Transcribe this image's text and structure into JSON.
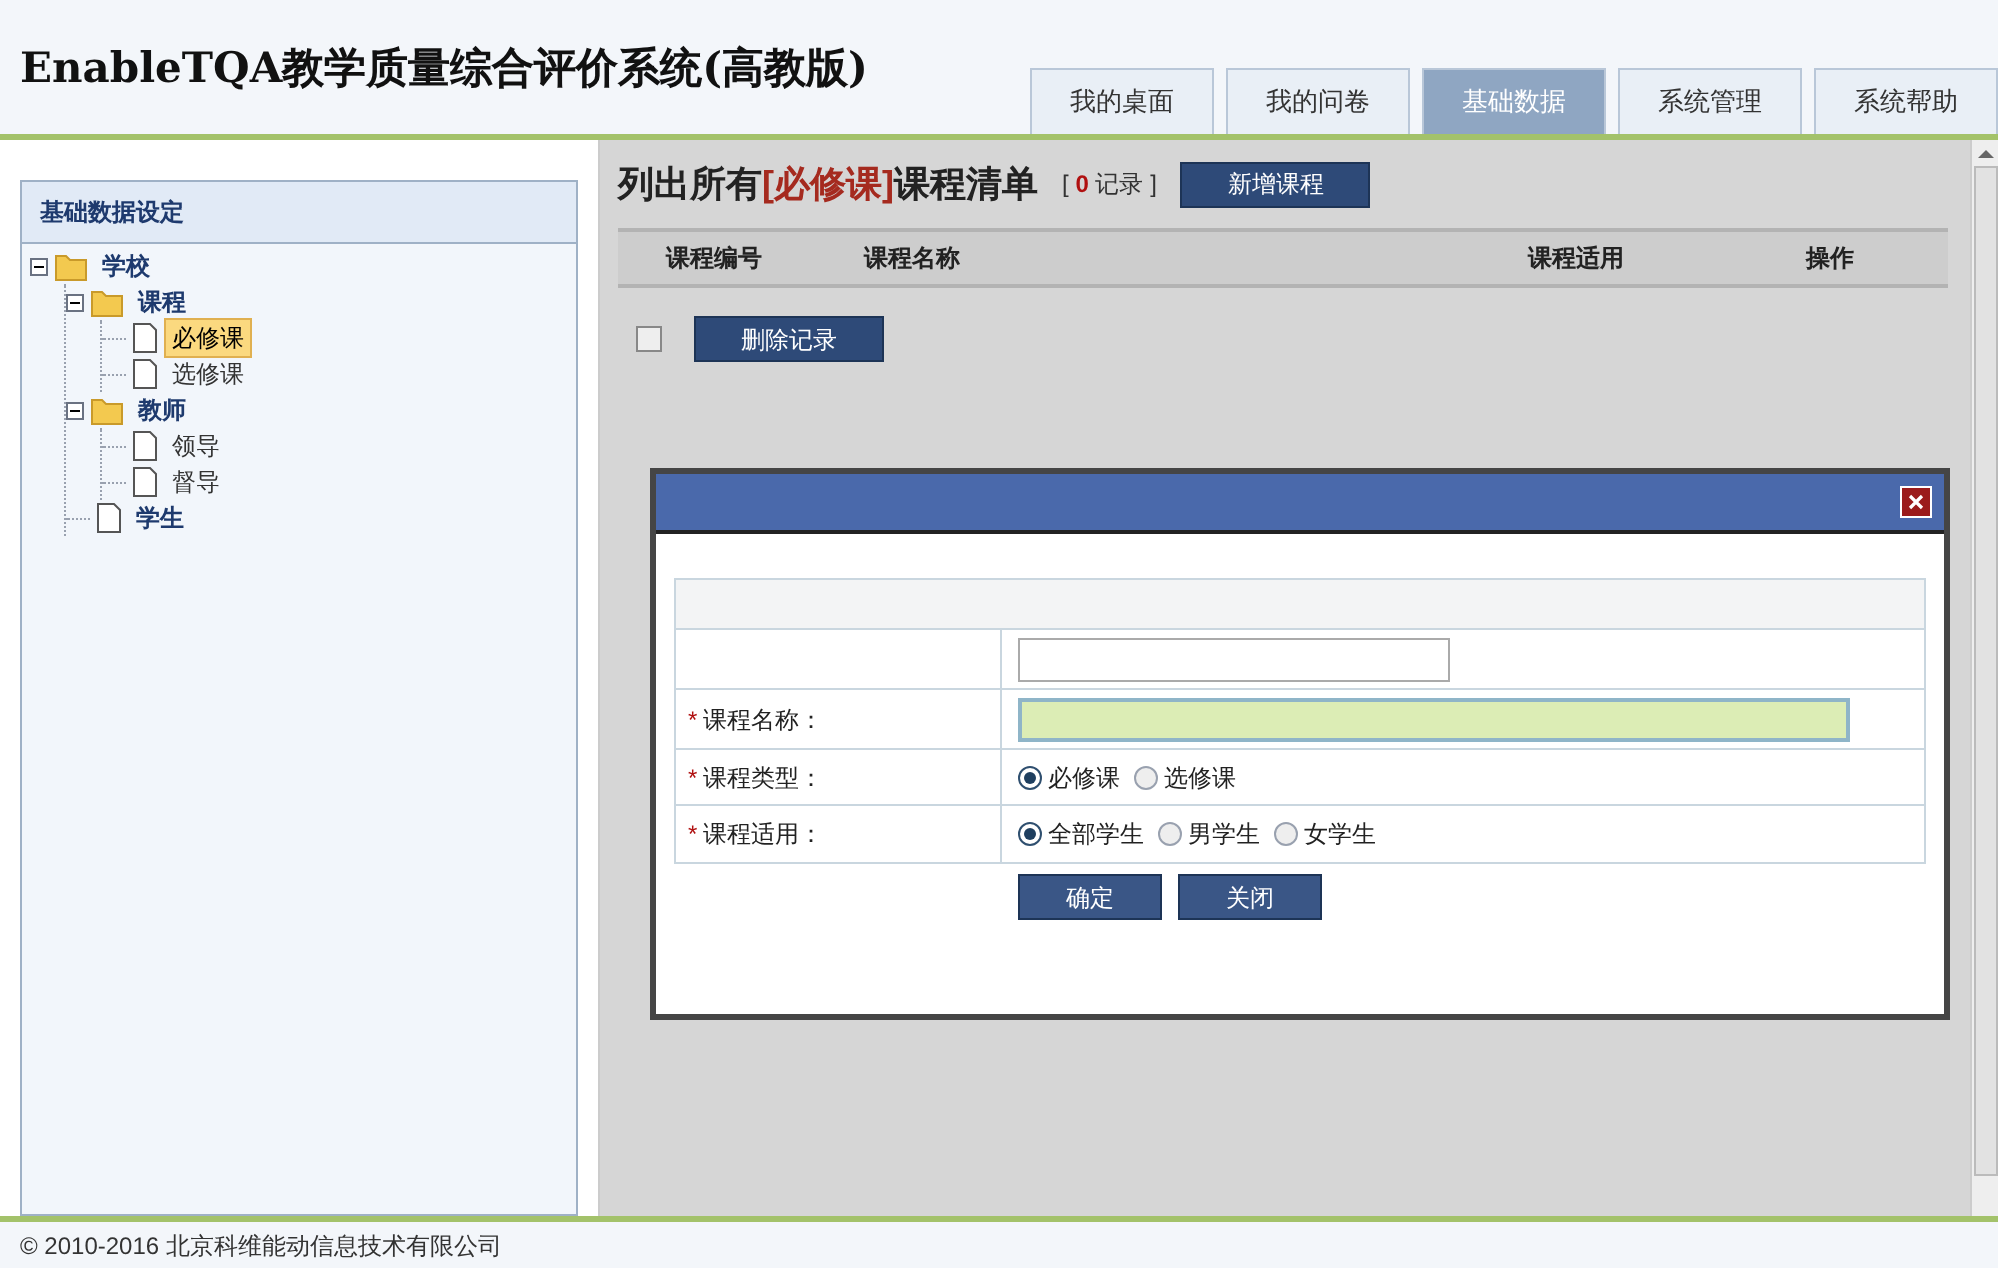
{
  "header": {
    "title": "EnableTQA教学质量综合评价系统(高教版)"
  },
  "nav_tabs": [
    {
      "label": "我的桌面",
      "selected": false
    },
    {
      "label": "我的问卷",
      "selected": false
    },
    {
      "label": "基础数据",
      "selected": true
    },
    {
      "label": "系统管理",
      "selected": false
    },
    {
      "label": "系统帮助",
      "selected": false
    }
  ],
  "sidebar": {
    "title": "基础数据设定",
    "tree": [
      {
        "label": "学校",
        "kind": "folder",
        "expanded": true,
        "selected": false,
        "children": [
          {
            "label": "课程",
            "kind": "folder",
            "expanded": true,
            "selected": false,
            "children": [
              {
                "label": "必修课",
                "kind": "file",
                "selected": true
              },
              {
                "label": "选修课",
                "kind": "file",
                "selected": false
              }
            ]
          },
          {
            "label": "教师",
            "kind": "folder",
            "expanded": true,
            "selected": false,
            "children": [
              {
                "label": "领导",
                "kind": "file",
                "selected": false
              },
              {
                "label": "督导",
                "kind": "file",
                "selected": false
              }
            ]
          },
          {
            "label": "学生",
            "kind": "file",
            "selected": false
          }
        ]
      }
    ]
  },
  "main": {
    "heading_before": "列出所有",
    "heading_highlight": "[必修课]",
    "heading_after": "课程清单",
    "record_open": "[",
    "record_count": "0",
    "record_label": "记录",
    "record_close": "]",
    "add_button": "新增课程",
    "columns": [
      "课程编号",
      "课程名称",
      "课程适用",
      "操作"
    ],
    "select_all": {
      "checked": false
    },
    "delete_button": "删除记录"
  },
  "dialog": {
    "rows": [
      {
        "kind": "text"
      },
      {
        "kind": "wide-text",
        "label": "课程名称：",
        "required_mark": "*"
      },
      {
        "kind": "radio",
        "label": "课程类型：",
        "required_mark": "*",
        "options": [
          {
            "label": "必修课",
            "selected": true
          },
          {
            "label": "选修课",
            "selected": false
          }
        ]
      },
      {
        "kind": "radio",
        "label": "课程适用：",
        "required_mark": "*",
        "options": [
          {
            "label": "全部学生",
            "selected": true
          },
          {
            "label": "男学生",
            "selected": false
          },
          {
            "label": "女学生",
            "selected": false
          }
        ]
      }
    ],
    "buttons": [
      "确定",
      "关闭"
    ]
  },
  "footer": {
    "copyright": "© 2010-2016 北京科维能动信息技术有限公司"
  }
}
